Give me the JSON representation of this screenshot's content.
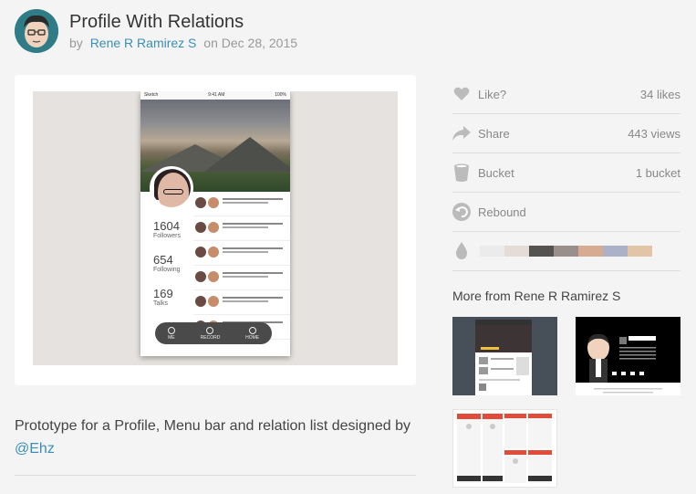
{
  "header": {
    "title": "Profile With Relations",
    "by_label": "by",
    "author": "Rene R Ramirez S",
    "on_label": "on",
    "date": "Dec 28, 2015"
  },
  "shot": {
    "status_left": "Sketch",
    "status_time": "9:41 AM",
    "status_right": "100%",
    "stats": [
      {
        "num": "1604",
        "label": "Followers"
      },
      {
        "num": "654",
        "label": "Following"
      },
      {
        "num": "169",
        "label": "Talks"
      }
    ],
    "menu": [
      {
        "label": "ME"
      },
      {
        "label": "RECORD"
      },
      {
        "label": "HOME"
      }
    ]
  },
  "description": {
    "text": "Prototype for a Profile, Menu bar and relation list designed by",
    "link": "@Ehz"
  },
  "stats": {
    "like_label": "Like?",
    "likes": "34 likes",
    "share_label": "Share",
    "views": "443 views",
    "bucket_label": "Bucket",
    "buckets": "1 bucket",
    "rebound_label": "Rebound"
  },
  "palette": [
    "#ebebeb",
    "#e5dcd8",
    "#555350",
    "#9b8f8b",
    "#d6ab91",
    "#acb1c8",
    "#e2c5a6"
  ],
  "more": {
    "title": "More from Rene R Ramirez S"
  },
  "colors": {
    "link": "#3a8fb7",
    "icon": "#bbbbbb"
  }
}
